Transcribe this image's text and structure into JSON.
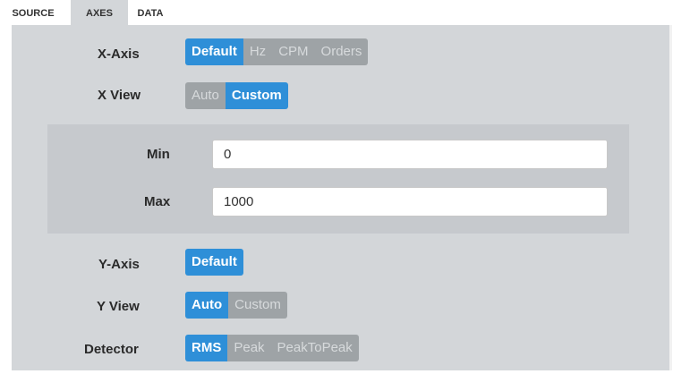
{
  "tabs": [
    {
      "label": "SOURCE",
      "active": false
    },
    {
      "label": "AXES",
      "active": true
    },
    {
      "label": "DATA",
      "active": false
    }
  ],
  "x_axis": {
    "label": "X-Axis",
    "options": [
      "Default",
      "Hz",
      "CPM",
      "Orders"
    ],
    "selected": "Default"
  },
  "x_view": {
    "label": "X View",
    "options": [
      "Auto",
      "Custom"
    ],
    "selected": "Custom"
  },
  "range": {
    "min_label": "Min",
    "min_value": "0",
    "max_label": "Max",
    "max_value": "1000"
  },
  "y_axis": {
    "label": "Y-Axis",
    "options": [
      "Default"
    ],
    "selected": "Default"
  },
  "y_view": {
    "label": "Y View",
    "options": [
      "Auto",
      "Custom"
    ],
    "selected": "Auto"
  },
  "detector": {
    "label": "Detector",
    "options": [
      "RMS",
      "Peak",
      "PeakToPeak"
    ],
    "selected": "RMS"
  },
  "colors": {
    "selected": "#2e8fd8",
    "unselected": "#9ea3a6",
    "panel": "#d3d6d9",
    "inner_panel": "#c6c9cd"
  }
}
